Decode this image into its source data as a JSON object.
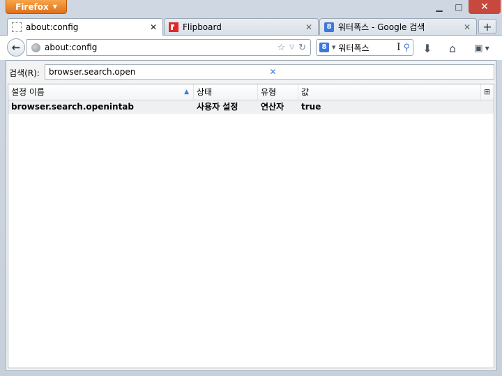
{
  "titlebar": {
    "app_button": "Firefox"
  },
  "tabs": [
    {
      "label": "about:config"
    },
    {
      "label": "Flipboard"
    },
    {
      "label": "워터폭스 - Google 검색"
    }
  ],
  "navbar": {
    "url": "about:config",
    "search_engine": "8",
    "search_text": "워터폭스"
  },
  "config": {
    "filter_label": "검색(R):",
    "filter_value": "browser.search.open",
    "columns": [
      "설정 이름",
      "상태",
      "유형",
      "값"
    ],
    "rows": [
      {
        "name": "browser.search.openintab",
        "status": "사용자 설정",
        "type": "연산자",
        "value": "true"
      }
    ]
  },
  "icons": {
    "back": "back-arrow-icon",
    "globe": "globe-icon",
    "star": "bookmark-star-icon",
    "reload": "reload-icon",
    "download": "download-icon",
    "home": "home-icon",
    "bookmarks": "bookmarks-menu-icon",
    "search": "magnifier-icon"
  },
  "colors": {
    "firefox_button": "#e8821f",
    "close_button": "#c7483c",
    "google_blue": "#3c79d8"
  }
}
